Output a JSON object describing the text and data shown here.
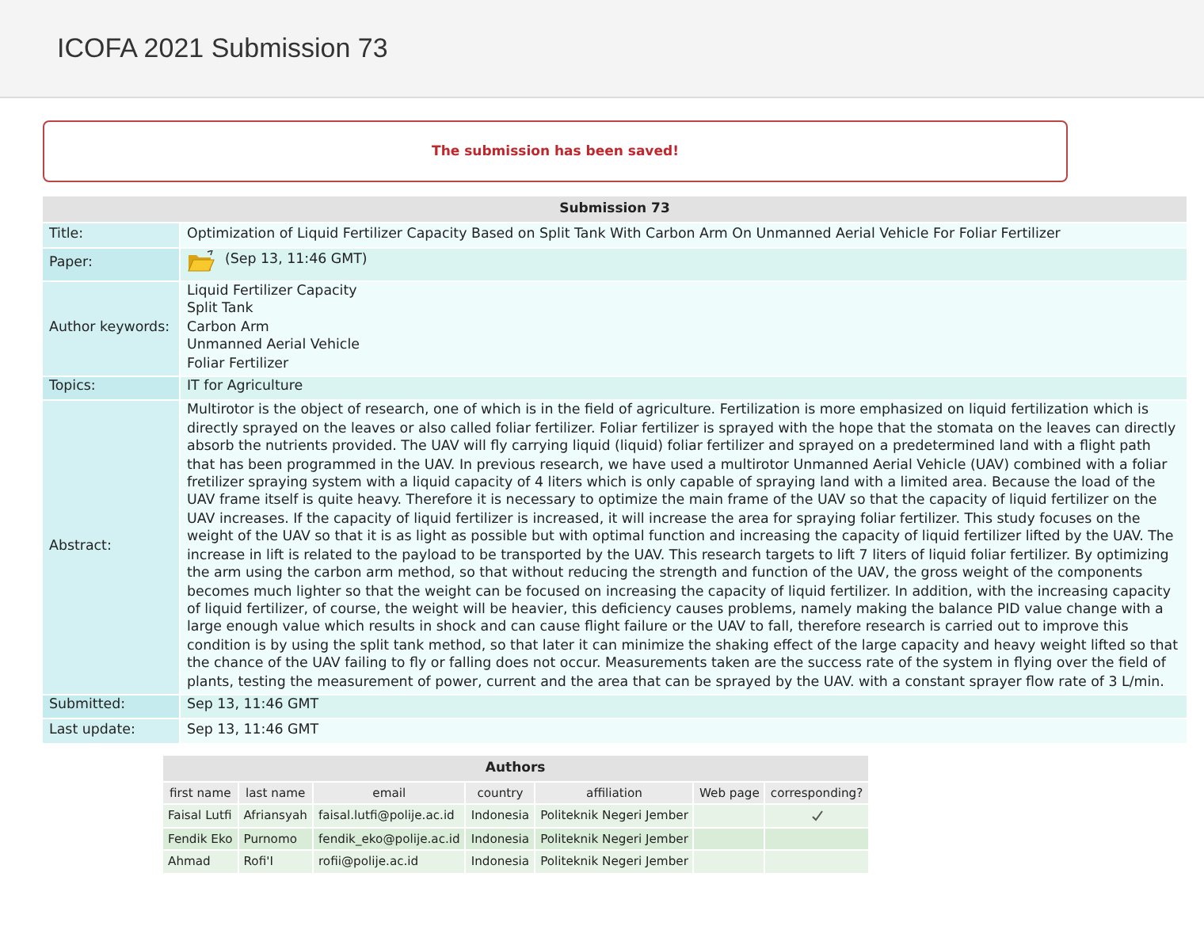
{
  "page_title": "ICOFA 2021 Submission 73",
  "message": "The submission has been saved!",
  "submission": {
    "heading": "Submission 73",
    "rows": [
      {
        "kind": "text",
        "label": "Title:",
        "value": "Optimization of Liquid Fertilizer Capacity Based on Split Tank With Carbon Arm On Unmanned Aerial Vehicle For Foliar Fertilizer"
      },
      {
        "kind": "file",
        "label": "Paper:",
        "value": "(Sep 13, 11:46 GMT)"
      },
      {
        "kind": "list",
        "label": "Author keywords:",
        "items": [
          "Liquid Fertilizer Capacity",
          "Split Tank",
          "Carbon Arm",
          "Unmanned Aerial Vehicle",
          "Foliar Fertilizer"
        ]
      },
      {
        "kind": "text",
        "label": "Topics:",
        "value": "IT for Agriculture"
      },
      {
        "kind": "text",
        "label": "Abstract:",
        "value": "Multirotor is the object of research, one of which is in the field of agriculture. Fertilization is more emphasized on liquid fertilization which is directly sprayed on the leaves or also called foliar fertilizer. Foliar fertilizer is sprayed with the hope that the stomata on the leaves can directly absorb the nutrients provided. The UAV will fly carrying liquid (liquid) foliar fertilizer and sprayed on a predetermined land with a flight path that has been programmed in the UAV. In previous research, we have used a multirotor Unmanned Aerial Vehicle (UAV) combined with a foliar fretilizer spraying system with a liquid capacity of 4 liters which is only capable of spraying land with a limited area. Because the load of the UAV frame itself is quite heavy. Therefore it is necessary to optimize the main frame of the UAV so that the capacity of liquid fertilizer on the UAV increases. If the capacity of liquid fertilizer is increased, it will increase the area for spraying foliar fertilizer. This study focuses on the weight of the UAV so that it is as light as possible but with optimal function and increasing the capacity of liquid fertilizer lifted by the UAV. The increase in lift is related to the payload to be transported by the UAV. This research targets to lift 7 liters of liquid foliar fertilizer. By optimizing the arm using the carbon arm method, so that without reducing the strength and function of the UAV, the gross weight of the components becomes much lighter so that the weight can be focused on increasing the capacity of liquid fertilizer. In addition, with the increasing capacity of liquid fertilizer, of course, the weight will be heavier, this deficiency causes problems, namely making the balance PID value change with a large enough value which results in shock and can cause flight failure or the UAV to fall, therefore research is carried out to improve this condition is by using the split tank method, so that later it can minimize the shaking effect of the large capacity and heavy weight lifted so that the chance of the UAV failing to fly or falling does not occur. Measurements taken are the success rate of the system in flying over the field of plants, testing the measurement of power, current and the area that can be sprayed by the UAV. with a constant sprayer flow rate of 3 L/min."
      },
      {
        "kind": "text",
        "label": "Submitted:",
        "value": "Sep 13, 11:46 GMT"
      },
      {
        "kind": "text",
        "label": "Last update:",
        "value": "Sep 13, 11:46 GMT"
      }
    ]
  },
  "authors": {
    "heading": "Authors",
    "columns": [
      "first name",
      "last name",
      "email",
      "country",
      "affiliation",
      "Web page",
      "corresponding?"
    ],
    "rows": [
      {
        "first_name": "Faisal Lutfi",
        "last_name": "Afriansyah",
        "email": "faisal.lutfi@polije.ac.id",
        "country": "Indonesia",
        "affiliation": "Politeknik Negeri Jember",
        "corresponding": true
      },
      {
        "first_name": "Fendik Eko",
        "last_name": "Purnomo",
        "email": "fendik_eko@polije.ac.id",
        "country": "Indonesia",
        "affiliation": "Politeknik Negeri Jember",
        "corresponding": false
      },
      {
        "first_name": "Ahmad",
        "last_name": "Rofi'I",
        "email": "rofii@polije.ac.id",
        "country": "Indonesia",
        "affiliation": "Politeknik Negeri Jember",
        "corresponding": false
      }
    ]
  }
}
